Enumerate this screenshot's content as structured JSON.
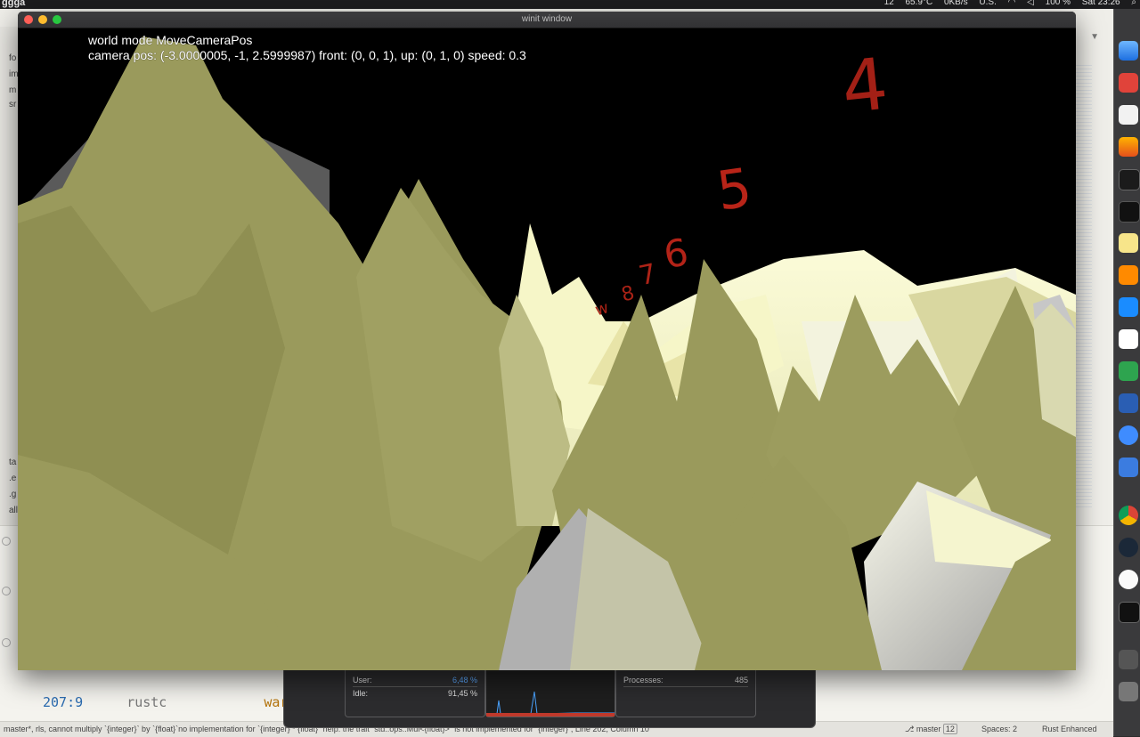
{
  "menubar": {
    "app_name": "ggga",
    "temperature": "65.9°C",
    "network": "0KB/s",
    "input_source": "U.S.",
    "battery": "100 %",
    "cpu_count": "12",
    "clock": "Sat 23:26"
  },
  "window": {
    "title": "winit window",
    "hud_line1": "world mode MoveCameraPos",
    "hud_line2": "camera pos: (-3.0000005, -1, 2.5999987) front: (0, 0, 1), up: (0, 1, 0) speed: 0.3",
    "floating_numbers": [
      "4",
      "5",
      "6",
      "7",
      "8",
      "w"
    ],
    "colors": {
      "mountain_olive": "#9a9a5c",
      "mountain_light": "#f2f2c4",
      "sky": "#000000",
      "number_red": "#c0261a"
    }
  },
  "editor": {
    "sidebar_labels": [
      "fo",
      "im",
      "m",
      "sr",
      "ta",
      ".e",
      ".g",
      "all"
    ],
    "code_line": {
      "location": "207:9",
      "source": "rustc",
      "level": "war"
    }
  },
  "activity_monitor": {
    "user_label": "User:",
    "user_value": "6,48 %",
    "idle_label": "Idle:",
    "idle_value": "91,45 %",
    "processes_label": "Processes:",
    "processes_value": "485"
  },
  "statusbar": {
    "message": "master*, rls, cannot multiply `{integer}` by `{float}`no implementation for `{integer} * {float}` help: the trait `std::ops::Mul<{float}>` is not implemented for `{integer}`, Line 202, Column 10",
    "branch": "master",
    "branch_count": "12",
    "spaces": "Spaces: 2",
    "syntax": "Rust Enhanced"
  }
}
